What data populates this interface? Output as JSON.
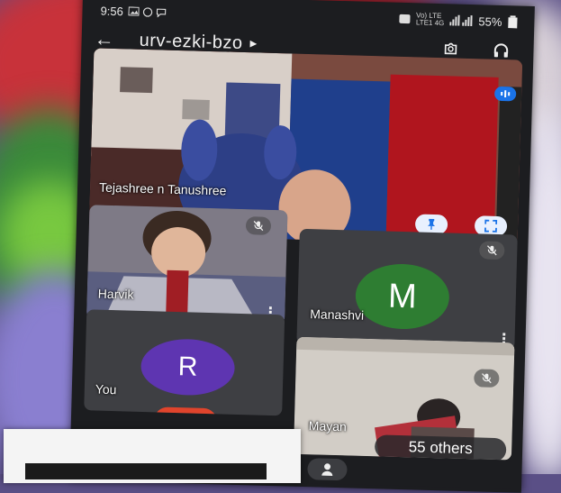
{
  "status": {
    "time": "9:56",
    "battery": "55%",
    "network_line1": "Vo) LTE",
    "network_line2": "LTE1 4G"
  },
  "meeting": {
    "code": "urv-ezki-bzo"
  },
  "tiles": {
    "main": {
      "name": "Tejashree n Tanushree"
    },
    "harvik": {
      "name": "Harvik"
    },
    "manashvi": {
      "name": "Manashvi",
      "initial": "M",
      "color": "#2e7d32"
    },
    "you": {
      "name": "You",
      "initial": "R",
      "color": "#5e35b1"
    },
    "mayan": {
      "name": "Mayan",
      "others": "55 others"
    }
  },
  "colors": {
    "accent": "#1a73e8",
    "bar": "#1c1d20"
  }
}
